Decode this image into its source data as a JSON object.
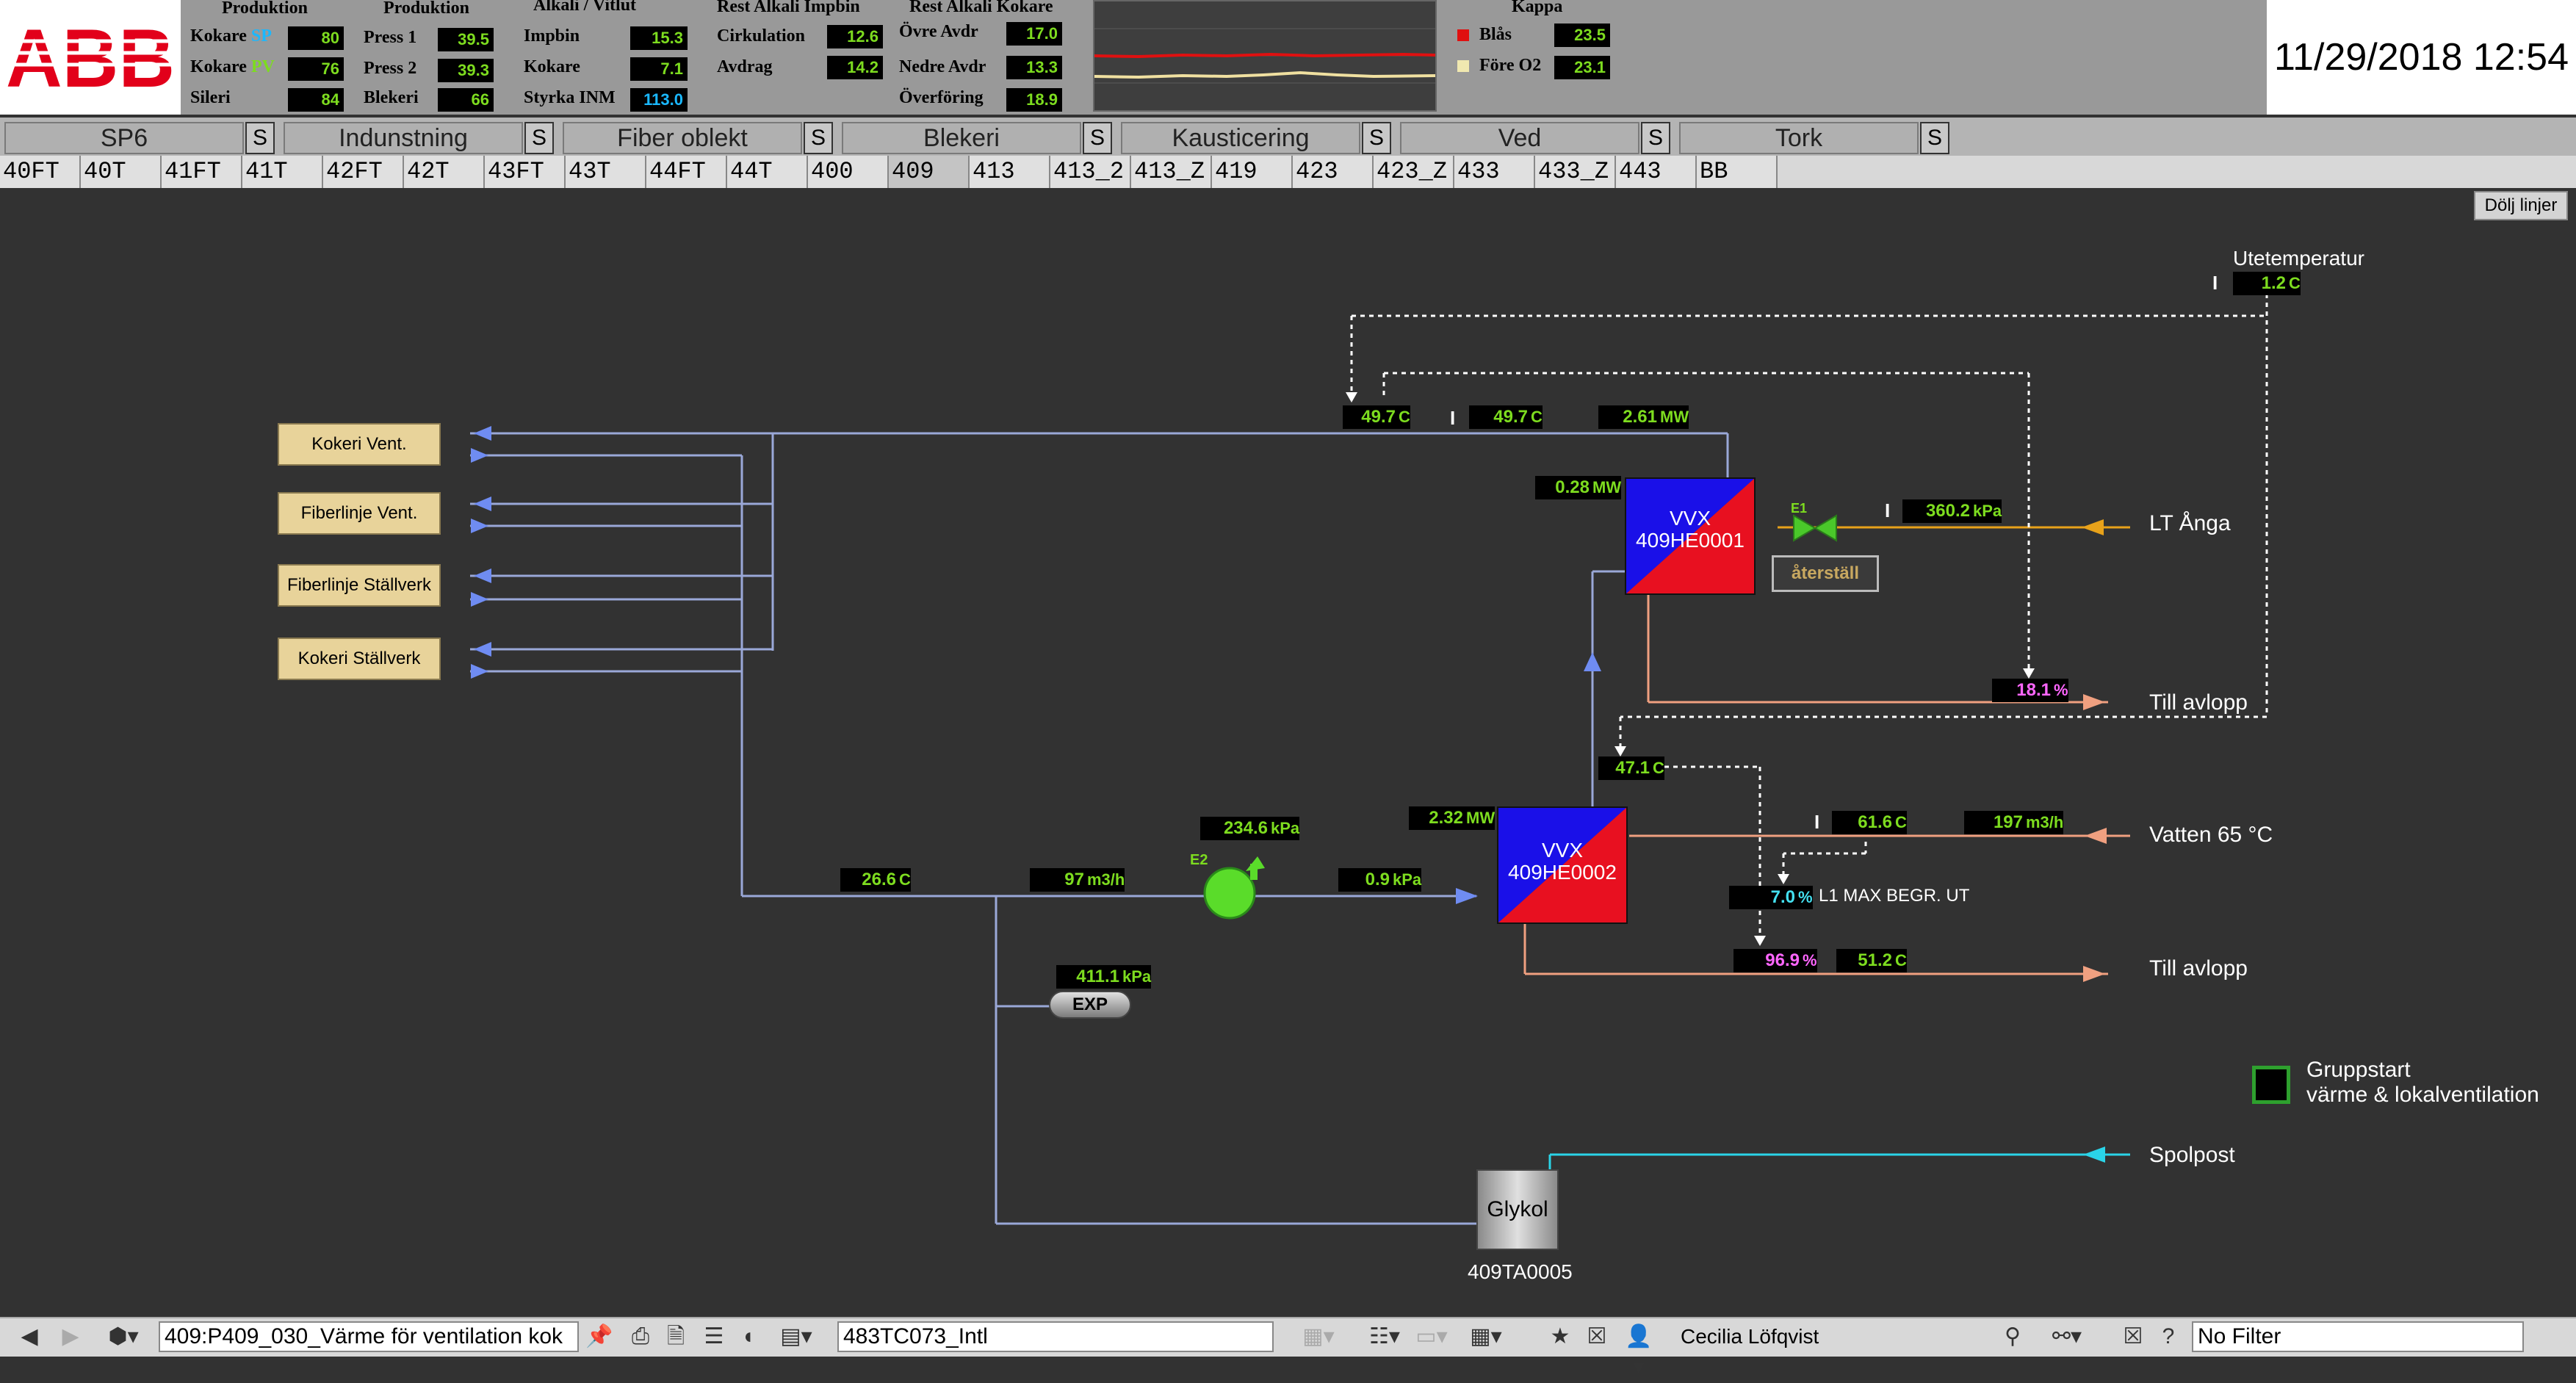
{
  "header": {
    "logo": "ABB",
    "groups": {
      "produktion1": {
        "title": "Produktion",
        "rows": [
          {
            "label": "Kokare",
            "tag": "SP",
            "value": "80"
          },
          {
            "label": "Kokare",
            "tag": "PV",
            "value": "76"
          },
          {
            "label": "Sileri",
            "tag": "",
            "value": "84"
          }
        ]
      },
      "produktion2": {
        "title": "Produktion",
        "rows": [
          {
            "label": "Press 1",
            "value": "39.5"
          },
          {
            "label": "Press 2",
            "value": "39.3"
          },
          {
            "label": "Blekeri",
            "value": "66"
          }
        ]
      },
      "alkali": {
        "title": "Alkali / Vitlut",
        "rows": [
          {
            "label": "Impbin",
            "value": "15.3"
          },
          {
            "label": "Kokare",
            "value": "7.1"
          },
          {
            "label": "Styrka INM",
            "value": "113.0"
          }
        ]
      },
      "rest_impbin": {
        "title": "Rest Alkali Impbin",
        "rows": [
          {
            "label": "Cirkulation",
            "value": "12.6"
          },
          {
            "label": "Avdrag",
            "value": "14.2"
          }
        ]
      },
      "rest_kokare": {
        "title": "Rest Alkali Kokare",
        "rows": [
          {
            "label": "Övre Avdr",
            "value": "17.0"
          },
          {
            "label": "Nedre Avdr",
            "value": "13.3"
          },
          {
            "label": "Överföring",
            "value": "18.9"
          }
        ]
      },
      "kappa": {
        "title": "Kappa",
        "rows": [
          {
            "label": "Blås",
            "value": "23.5"
          },
          {
            "label": "Före O2",
            "value": "23.1"
          }
        ]
      }
    },
    "datetime": "11/29/2018 12:54",
    "colors": {
      "trend_red": "#e01010",
      "trend_yellow": "#f0e0a0",
      "kappa_blas": "#e01010",
      "kappa_fore": "#f0e8b0"
    }
  },
  "tabs": [
    {
      "label": "SP6",
      "s": "S"
    },
    {
      "label": "Indunstning",
      "s": "S"
    },
    {
      "label": "Fiber oblekt",
      "s": "S"
    },
    {
      "label": "Blekeri",
      "s": "S"
    },
    {
      "label": "Kausticering",
      "s": "S"
    },
    {
      "label": "Ved",
      "s": "S"
    },
    {
      "label": "Tork",
      "s": "S"
    }
  ],
  "subtabs": [
    "40FT",
    "40T",
    "41FT",
    "41T",
    "42FT",
    "42T",
    "43FT",
    "43T",
    "44FT",
    "44T",
    "400",
    "409",
    "413",
    "413_2",
    "413_Z",
    "419",
    "423",
    "423_Z",
    "433",
    "433_Z",
    "443",
    "BB"
  ],
  "process": {
    "dolj_linjer": "Dölj linjer",
    "utetemperatur": {
      "label": "Utetemperatur",
      "value": "1.2",
      "unit": "C"
    },
    "vents": [
      "Kokeri Vent.",
      "Fiberlinje Vent.",
      "Fiberlinje Ställverk",
      "Kokeri Ställverk"
    ],
    "top_temp1": {
      "value": "49.7",
      "unit": "C"
    },
    "top_temp2": {
      "value": "49.7",
      "unit": "C"
    },
    "top_power": {
      "value": "2.61",
      "unit": "MW"
    },
    "vvx1": {
      "title": "VVX",
      "tag": "409HE0001",
      "power": "0.28",
      "power_unit": "MW"
    },
    "vvx2": {
      "title": "VVX",
      "tag": "409HE0002",
      "power": "2.32",
      "power_unit": "MW"
    },
    "valve_e1": {
      "label": "E1",
      "pressure": "360.2",
      "unit": "kPa"
    },
    "aterstall": "återställ",
    "lt_anga": "LT Ånga",
    "till_avlopp1": {
      "label": "Till avlopp",
      "value": "18.1",
      "unit": "%"
    },
    "temp_mid": {
      "value": "47.1",
      "unit": "C"
    },
    "vatten": {
      "label": "Vatten 65 °C",
      "temp": "61.6",
      "temp_unit": "C",
      "flow": "197",
      "flow_unit": "m3/h"
    },
    "l1max": {
      "value": "7.0",
      "unit": "%",
      "label": "L1 MAX BEGR. UT"
    },
    "till_avlopp2": {
      "label": "Till avlopp",
      "value": "96.9",
      "unit": "%",
      "temp": "51.2",
      "temp_unit": "C"
    },
    "return_temp": {
      "value": "26.6",
      "unit": "C"
    },
    "flow": {
      "value": "97",
      "unit": "m3/h"
    },
    "pump_e2": {
      "label": "E2",
      "pressure": "234.6",
      "unit": "kPa"
    },
    "dp": {
      "value": "0.9",
      "unit": "kPa"
    },
    "exp": {
      "label": "EXP",
      "pressure": "411.1",
      "unit": "kPa"
    },
    "glykol": {
      "label": "Glykol",
      "tag": "409TA0005"
    },
    "spolpost": "Spolpost",
    "gruppstart": {
      "line1": "Gruppstart",
      "line2": "värme & lokalventilation"
    }
  },
  "toolbar": {
    "display_path": "409:P409_030_Värme för ventilation kok",
    "object_field": "483TC073_Intl",
    "user": "Cecilia Löfqvist",
    "filter": "No Filter"
  }
}
